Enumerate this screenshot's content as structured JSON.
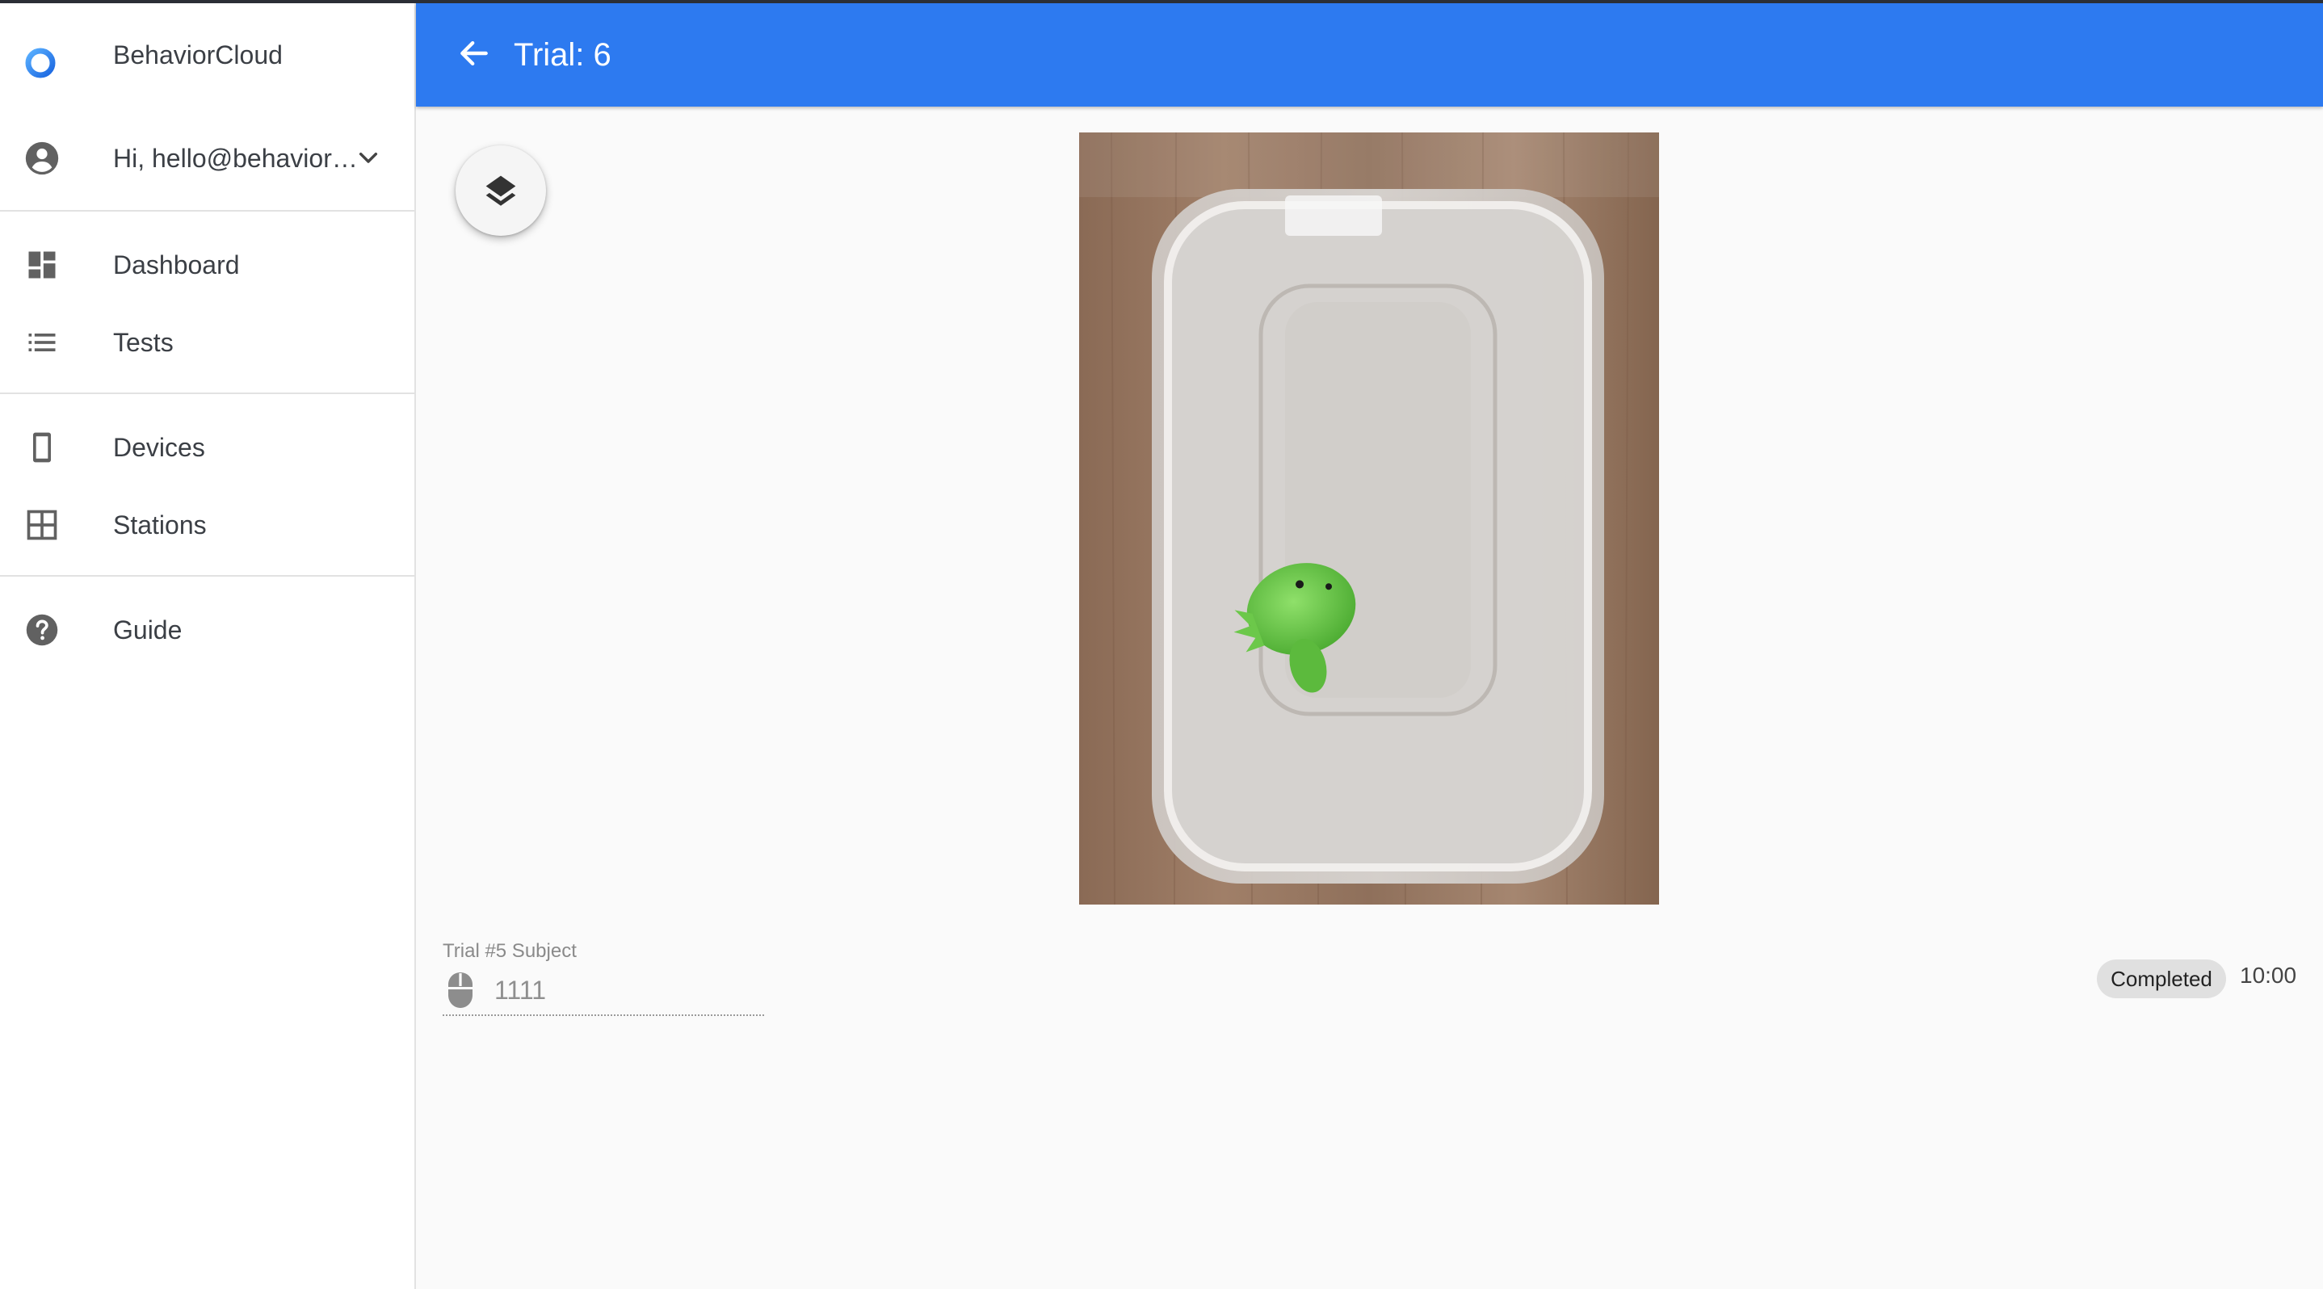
{
  "app": {
    "name": "BehaviorCloud",
    "brand_color": "#2d7af0"
  },
  "user": {
    "greeting": "Hi, hello@behavior…",
    "icon": "account-circle-icon"
  },
  "sidebar": {
    "groups": [
      [
        {
          "label": "Dashboard",
          "icon": "dashboard-icon"
        },
        {
          "label": "Tests",
          "icon": "list-icon"
        }
      ],
      [
        {
          "label": "Devices",
          "icon": "phone-icon"
        },
        {
          "label": "Stations",
          "icon": "grid-icon"
        }
      ],
      [
        {
          "label": "Guide",
          "icon": "help-icon"
        }
      ]
    ]
  },
  "header": {
    "title": "Trial: 6",
    "back_icon": "arrow-back-icon"
  },
  "toolbar": {
    "layers_icon": "layers-icon"
  },
  "trial": {
    "subject_label": "Trial #5 Subject",
    "subject_value": "1111",
    "subject_icon": "mouse-icon",
    "status": "Completed",
    "duration": "10:00"
  }
}
